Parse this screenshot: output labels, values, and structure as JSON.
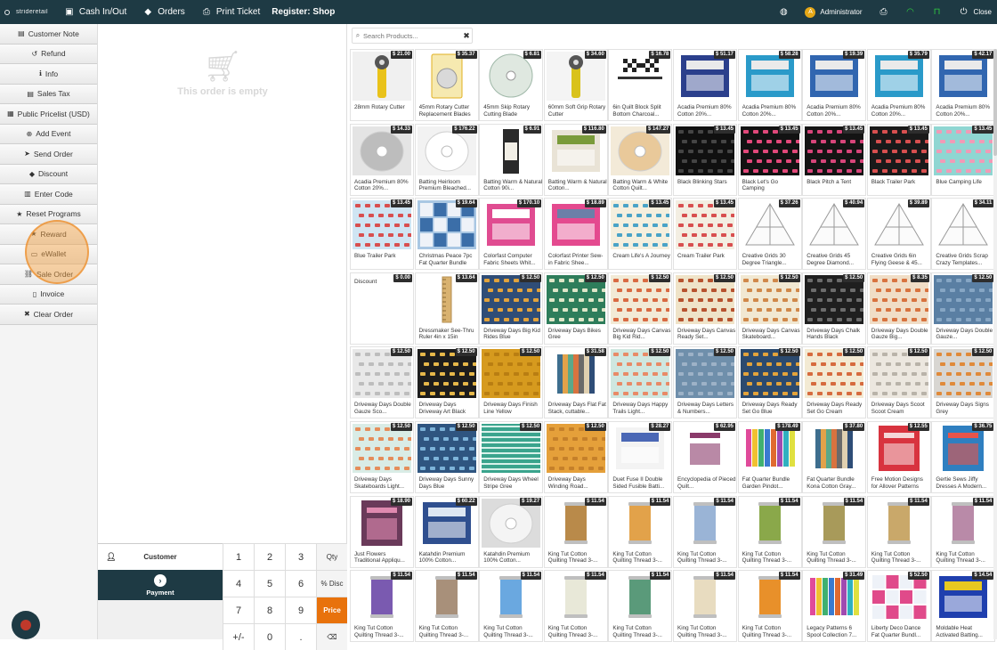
{
  "topbar": {
    "logo": "strideretail",
    "cash": "Cash In/Out",
    "orders": "Orders",
    "print_ticket": "Print Ticket",
    "register": "Register: Shop",
    "user_initial": "A",
    "user": "Administrator",
    "close": "Close"
  },
  "actions": [
    {
      "icon": "note-icon",
      "glyph": "▤",
      "label": "Customer Note"
    },
    {
      "icon": "undo-icon",
      "glyph": "↺",
      "label": "Refund"
    },
    {
      "icon": "info-icon",
      "glyph": "ℹ",
      "label": "Info"
    },
    {
      "icon": "book-icon",
      "glyph": "▤",
      "label": "Sales Tax"
    },
    {
      "icon": "table-icon",
      "glyph": "▦",
      "label": "Public Pricelist (USD)"
    },
    {
      "icon": "plus-circle-icon",
      "glyph": "⊕",
      "label": "Add Event"
    },
    {
      "icon": "paper-plane-icon",
      "glyph": "➤",
      "label": "Send Order"
    },
    {
      "icon": "tag-icon",
      "glyph": "◆",
      "label": "Discount"
    },
    {
      "icon": "barcode-icon",
      "glyph": "▥",
      "label": "Enter Code"
    },
    {
      "icon": "star-icon",
      "glyph": "★",
      "label": "Reset Programs"
    },
    {
      "icon": "star-icon",
      "glyph": "★",
      "label": "Reward"
    },
    {
      "icon": "wallet-icon",
      "glyph": "▭",
      "label": "eWallet"
    },
    {
      "icon": "link-icon",
      "glyph": "⛓",
      "label": "Sale Order"
    },
    {
      "icon": "file-icon",
      "glyph": "▯",
      "label": "Invoice"
    },
    {
      "icon": "close-icon",
      "glyph": "✖",
      "label": "Clear Order"
    }
  ],
  "order": {
    "empty_text": "This order is empty",
    "customer_label": "Customer",
    "payment_label": "Payment"
  },
  "keypad": [
    {
      "k": "1",
      "mode": false
    },
    {
      "k": "2",
      "mode": false
    },
    {
      "k": "3",
      "mode": false
    },
    {
      "k": "Qty",
      "mode": true
    },
    {
      "k": "4",
      "mode": false
    },
    {
      "k": "5",
      "mode": false
    },
    {
      "k": "6",
      "mode": false
    },
    {
      "k": "% Disc",
      "mode": true
    },
    {
      "k": "7",
      "mode": false
    },
    {
      "k": "8",
      "mode": false
    },
    {
      "k": "9",
      "mode": false
    },
    {
      "k": "Price",
      "mode": true,
      "active": true
    },
    {
      "k": "+/-",
      "mode": false
    },
    {
      "k": "0",
      "mode": false
    },
    {
      "k": ".",
      "mode": false
    },
    {
      "k": "⌫",
      "mode": true
    }
  ],
  "search": {
    "placeholder": "Search Products..."
  },
  "products": [
    {
      "name": "28mm Rotary Cutter",
      "price": "$ 21.00",
      "c": "#f0f0f0",
      "p": "cutter",
      "a": "#e9c21a"
    },
    {
      "name": "45mm Rotary Cutter Replacement Blades",
      "price": "$ 35.37",
      "c": "#f6e9b0",
      "p": "pack",
      "a": "#e0b020"
    },
    {
      "name": "45mm Skip Rotary Cutting Blade",
      "price": "$ 6.81",
      "c": "#f7f7f7",
      "p": "disc",
      "a": "#dfe8e0"
    },
    {
      "name": "60mm Soft Grip Rotary Cutter",
      "price": "$ 34.60",
      "c": "#f4f4f4",
      "p": "cutter",
      "a": "#d9c21b"
    },
    {
      "name": "6in Quilt Block Split Bottom Charcoal...",
      "price": "$ 16.78",
      "c": "#ffffff",
      "p": "flag",
      "a": "#222222"
    },
    {
      "name": "Acadia Premium 80% Cotton 20%...",
      "price": "$ 51.17",
      "c": "#2b3f8c",
      "p": "box",
      "a": "#eaeaea"
    },
    {
      "name": "Acadia Premium 80% Cotton 20%...",
      "price": "$ 58.28",
      "c": "#2a9ac9",
      "p": "box",
      "a": "#eaeaea"
    },
    {
      "name": "Acadia Premium 80% Cotton 20%...",
      "price": "$ 19.39",
      "c": "#3166b0",
      "p": "box",
      "a": "#eaeaea"
    },
    {
      "name": "Acadia Premium 80% Cotton 20%...",
      "price": "$ 35.79",
      "c": "#2a9ac9",
      "p": "box",
      "a": "#eaeaea"
    },
    {
      "name": "Acadia Premium 80% Cotton 20%...",
      "price": "$ 42.17",
      "c": "#3166b0",
      "p": "box",
      "a": "#eaeaea"
    },
    {
      "name": "Acadia Premium 80% Cotton 20%...",
      "price": "$ 14.33",
      "c": "#e4e4e4",
      "p": "roll",
      "a": "#bdbdbd"
    },
    {
      "name": "Batting Heirloom Premium Bleached...",
      "price": "$ 176.22",
      "c": "#f2f2f2",
      "p": "roll",
      "a": "#ffffff"
    },
    {
      "name": "Batting Warm & Natural Cotton 90i...",
      "price": "$ 6.91",
      "c": "#ffffff",
      "p": "tube",
      "a": "#2a2a2a"
    },
    {
      "name": "Batting Warm & Natural Cotton...",
      "price": "$ 116.80",
      "c": "#e9e3d6",
      "p": "box",
      "a": "#7a9b3a"
    },
    {
      "name": "Batting Warm & White Cotton Quilt...",
      "price": "$ 147.27",
      "c": "#f3ead8",
      "p": "roll",
      "a": "#e9c99a"
    },
    {
      "name": "Black Blinking Stars",
      "price": "$ 13.45",
      "c": "#101010",
      "p": "dots",
      "a": "#444444"
    },
    {
      "name": "Black Let's Go Camping",
      "price": "$ 13.45",
      "c": "#121212",
      "p": "dots",
      "a": "#e2487a"
    },
    {
      "name": "Black Pitch a Tent",
      "price": "$ 13.45",
      "c": "#141414",
      "p": "dots",
      "a": "#d8457a"
    },
    {
      "name": "Black Trailer Park",
      "price": "$ 13.45",
      "c": "#1a1a1a",
      "p": "dots",
      "a": "#d84f4f"
    },
    {
      "name": "Blue Camping Life",
      "price": "$ 13.45",
      "c": "#8fd6d2",
      "p": "dots",
      "a": "#f19ab6"
    },
    {
      "name": "Blue Trailer Park",
      "price": "$ 13.45",
      "c": "#cfe5f3",
      "p": "dots",
      "a": "#d84f4f"
    },
    {
      "name": "Christmas Peace 7pc Fat Quarter Bundle",
      "price": "$ 19.64",
      "c": "#a9c7e3",
      "p": "quilt",
      "a": "#3b6ea8"
    },
    {
      "name": "Colorfast Computer Fabric Sheets Whit...",
      "price": "$ 170.10",
      "c": "#e04c91",
      "p": "box",
      "a": "#ffffff"
    },
    {
      "name": "Colorfast Printer Sew-in Fabric Shee...",
      "price": "$ 18.89",
      "c": "#e44a8f",
      "p": "box",
      "a": "#6b7fa8"
    },
    {
      "name": "Cream Life's A Journey",
      "price": "$ 13.45",
      "c": "#f5efde",
      "p": "dots",
      "a": "#4aa3c7"
    },
    {
      "name": "Cream Trailer Park",
      "price": "$ 13.45",
      "c": "#f3eee2",
      "p": "dots",
      "a": "#d84f4f"
    },
    {
      "name": "Creative Grids 30 Degree Triangle...",
      "price": "$ 37.26",
      "c": "#ffffff",
      "p": "ruler",
      "a": "#9a9a9a"
    },
    {
      "name": "Creative Grids 45 Degree Diamond...",
      "price": "$ 40.94",
      "c": "#ffffff",
      "p": "ruler",
      "a": "#9a9a9a"
    },
    {
      "name": "Creative Grids 6in Flying Geese & 45...",
      "price": "$ 39.89",
      "c": "#ffffff",
      "p": "ruler",
      "a": "#9a9a9a"
    },
    {
      "name": "Creative Grids Scrap Crazy Templates...",
      "price": "$ 34.11",
      "c": "#ffffff",
      "p": "ruler",
      "a": "#9a9a9a"
    },
    {
      "name": "Discount",
      "price": "$ 0.00",
      "c": "#ffffff",
      "p": "none",
      "a": "#ffffff"
    },
    {
      "name": "Dressmaker See-Thru Ruler 4in x 15in",
      "price": "$ 13.64",
      "c": "#ffffff",
      "p": "stick",
      "a": "#d9b270"
    },
    {
      "name": "Driveway Days Big Kid Rides Blue",
      "price": "$ 12.50",
      "c": "#2f4d77",
      "p": "dots",
      "a": "#e3a33b"
    },
    {
      "name": "Driveway Days Bikes Gree",
      "price": "$ 12.50",
      "c": "#2e7d5b",
      "p": "dots",
      "a": "#dfe6c8"
    },
    {
      "name": "Driveway Days Canvas Big Kid Rid...",
      "price": "$ 12.50",
      "c": "#f2ead6",
      "p": "dots",
      "a": "#d96a42"
    },
    {
      "name": "Driveway Days Canvas Ready Set...",
      "price": "$ 12.50",
      "c": "#efe3c8",
      "p": "dots",
      "a": "#b7532f"
    },
    {
      "name": "Driveway Days Canvas Skateboard...",
      "price": "$ 12.50",
      "c": "#f1e8d2",
      "p": "dots",
      "a": "#d0884a"
    },
    {
      "name": "Driveway Days Chalk Hands Black",
      "price": "$ 12.50",
      "c": "#1f1f1f",
      "p": "dots",
      "a": "#6c6c6c"
    },
    {
      "name": "Driveway Days Double Gauze Big...",
      "price": "$ 8.35",
      "c": "#f0ddc6",
      "p": "dots",
      "a": "#d8733f"
    },
    {
      "name": "Driveway Days Double Gauze...",
      "price": "$ 12.50",
      "c": "#5a7fa3",
      "p": "dots",
      "a": "#86a6c4"
    },
    {
      "name": "Driveway Days Double Gauze Sco...",
      "price": "$ 12.50",
      "c": "#e8e8e8",
      "p": "dots",
      "a": "#bdbdbd"
    },
    {
      "name": "Driveway Days Driveway Art Black",
      "price": "$ 12.50",
      "c": "#1d1d1d",
      "p": "dots",
      "a": "#e6b84a"
    },
    {
      "name": "Driveway Days Finish Line Yellow",
      "price": "$ 12.50",
      "c": "#d69a1e",
      "p": "dots",
      "a": "#b97e12"
    },
    {
      "name": "Driveway Days Flat Fat Stack, cuttable...",
      "price": "$ 31.58",
      "c": "#ffffff",
      "p": "stack",
      "a": "#4a6d8c"
    },
    {
      "name": "Driveway Days Happy Trails Light...",
      "price": "$ 12.50",
      "c": "#cfe7e0",
      "p": "dots",
      "a": "#e88a67"
    },
    {
      "name": "Driveway Days Letters & Numbers...",
      "price": "$ 12.50",
      "c": "#6f8fab",
      "p": "dots",
      "a": "#9db2c7"
    },
    {
      "name": "Driveway Days Ready Set Go Blue",
      "price": "$ 12.50",
      "c": "#2c4a6e",
      "p": "dots",
      "a": "#e3a33b"
    },
    {
      "name": "Driveway Days Ready Set Go Cream",
      "price": "$ 12.50",
      "c": "#f3ead3",
      "p": "dots",
      "a": "#d66b3e"
    },
    {
      "name": "Driveway Days Scoot Scoot Cream",
      "price": "$ 12.50",
      "c": "#ece7df",
      "p": "dots",
      "a": "#b9b3a9"
    },
    {
      "name": "Driveway Days Signs Grey",
      "price": "$ 12.50",
      "c": "#d8d6d2",
      "p": "dots",
      "a": "#e08a3a"
    },
    {
      "name": "Driveway Days Skateboards Light...",
      "price": "$ 12.50",
      "c": "#d9ece6",
      "p": "dots",
      "a": "#e58d5a"
    },
    {
      "name": "Driveway Days Sunny Days Blue",
      "price": "$ 12.50",
      "c": "#2f5580",
      "p": "dots",
      "a": "#7db3d9"
    },
    {
      "name": "Driveway Days Wheel Stripe Gree",
      "price": "$ 12.50",
      "c": "#3aa48d",
      "p": "stripe",
      "a": "#d8f1ea"
    },
    {
      "name": "Driveway Days Winding Road...",
      "price": "$ 12.50",
      "c": "#e5a03a",
      "p": "dots",
      "a": "#c5802a"
    },
    {
      "name": "Duet Fuse II Double Sided Fusible Batti...",
      "price": "$ 28.27",
      "c": "#f3f3f3",
      "p": "box",
      "a": "#4a67b5"
    },
    {
      "name": "Encyclopedia of Pieced Quilt...",
      "price": "$ 62.95",
      "c": "#ffffff",
      "p": "book",
      "a": "#8a3a6a"
    },
    {
      "name": "Fat Quarter Bundle Garden Pindot...",
      "price": "$ 178.49",
      "c": "#ffffff",
      "p": "bars",
      "a": "#e04a9a"
    },
    {
      "name": "Fat Quarter Bundle Kona Cotton Gray...",
      "price": "$ 37.80",
      "c": "#ffffff",
      "p": "stack",
      "a": "#8a8a8a"
    },
    {
      "name": "Free Motion Designs for Allover Patterns",
      "price": "$ 12.55",
      "c": "#d8333f",
      "p": "book",
      "a": "#f5d7d9"
    },
    {
      "name": "Gertie Sews Jiffy Dresses A Modern...",
      "price": "$ 36.75",
      "c": "#2f7fc0",
      "p": "book",
      "a": "#e8544a"
    },
    {
      "name": "Just Flowers Traditional Appliqu...",
      "price": "$ 18.90",
      "c": "#6a3a5a",
      "p": "book",
      "a": "#e08ab0"
    },
    {
      "name": "Katahdin Premium 100% Cotton...",
      "price": "$ 60.22",
      "c": "#2f4f8f",
      "p": "box",
      "a": "#dde6f2"
    },
    {
      "name": "Katahdin Premium 100% Cotton...",
      "price": "$ 19.27",
      "c": "#dcdcdc",
      "p": "roll",
      "a": "#f4f4f4"
    },
    {
      "name": "King Tut Cotton Quilting Thread 3-...",
      "price": "$ 11.54",
      "c": "#ffffff",
      "p": "spool",
      "a": "#b98a4a"
    },
    {
      "name": "King Tut Cotton Quilting Thread 3-...",
      "price": "$ 11.54",
      "c": "#ffffff",
      "p": "spool",
      "a": "#e2a24a"
    },
    {
      "name": "King Tut Cotton Quilting Thread 3-...",
      "price": "$ 11.54",
      "c": "#ffffff",
      "p": "spool",
      "a": "#9ab4d6"
    },
    {
      "name": "King Tut Cotton Quilting Thread 3-...",
      "price": "$ 11.54",
      "c": "#ffffff",
      "p": "spool",
      "a": "#8aa84a"
    },
    {
      "name": "King Tut Cotton Quilting Thread 3-...",
      "price": "$ 11.54",
      "c": "#ffffff",
      "p": "spool",
      "a": "#a89a5a"
    },
    {
      "name": "King Tut Cotton Quilting Thread 3-...",
      "price": "$ 11.54",
      "c": "#ffffff",
      "p": "spool",
      "a": "#c9a86a"
    },
    {
      "name": "King Tut Cotton Quilting Thread 3-...",
      "price": "$ 11.54",
      "c": "#ffffff",
      "p": "spool",
      "a": "#b98aa8"
    },
    {
      "name": "King Tut Cotton Quilting Thread 3-...",
      "price": "$ 11.54",
      "c": "#ffffff",
      "p": "spool",
      "a": "#7a5ab0"
    },
    {
      "name": "King Tut Cotton Quilting Thread 3-...",
      "price": "$ 11.54",
      "c": "#ffffff",
      "p": "spool",
      "a": "#a8907a"
    },
    {
      "name": "King Tut Cotton Quilting Thread 3-...",
      "price": "$ 11.54",
      "c": "#ffffff",
      "p": "spool",
      "a": "#6aa8e0"
    },
    {
      "name": "King Tut Cotton Quilting Thread 3-...",
      "price": "$ 11.54",
      "c": "#ffffff",
      "p": "spool",
      "a": "#e8e8d8"
    },
    {
      "name": "King Tut Cotton Quilting Thread 3-...",
      "price": "$ 11.54",
      "c": "#ffffff",
      "p": "spool",
      "a": "#5a9a7a"
    },
    {
      "name": "King Tut Cotton Quilting Thread 3-...",
      "price": "$ 11.54",
      "c": "#ffffff",
      "p": "spool",
      "a": "#e8dcc0"
    },
    {
      "name": "King Tut Cotton Quilting Thread 3-...",
      "price": "$ 11.54",
      "c": "#ffffff",
      "p": "spool",
      "a": "#e8902a"
    },
    {
      "name": "Legacy Patterns 6 Spool Collection 7...",
      "price": "$ 31.49",
      "c": "#ffffff",
      "p": "bars",
      "a": "#7a4a8a"
    },
    {
      "name": "Liberty Deco Dance Fat Quarter Bundl...",
      "price": "$ 52.50",
      "c": "#ffffff",
      "p": "quilt",
      "a": "#e04a8a"
    },
    {
      "name": "Moldable Heat Activated Batting...",
      "price": "$ 14.54",
      "c": "#1f3fae",
      "p": "box",
      "a": "#e8c820"
    }
  ]
}
